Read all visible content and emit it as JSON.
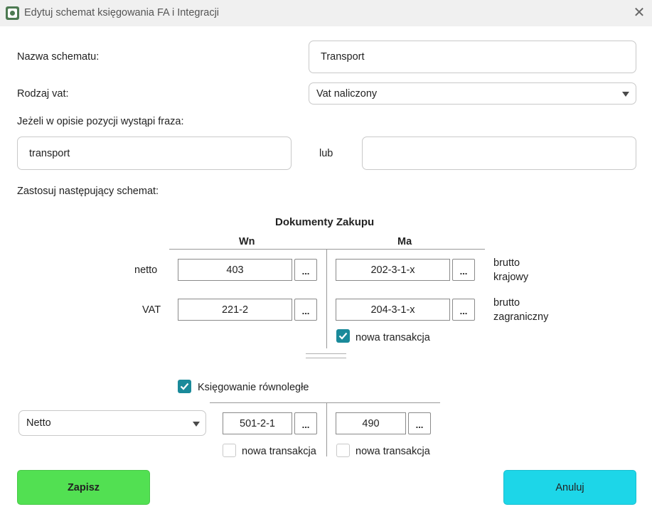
{
  "window": {
    "title": "Edytuj schemat księgowania FA i Integracji"
  },
  "form": {
    "scheme_name_label": "Nazwa schematu:",
    "scheme_name_value": "Transport",
    "vat_type_label": "Rodzaj vat:",
    "vat_type_value": "Vat naliczony",
    "phrase_label": "Jeżeli w opisie pozycji wystąpi fraza:",
    "phrase1_value": "transport",
    "or_label": "lub",
    "phrase2_value": "",
    "apply_label": "Zastosuj następujący schemat:"
  },
  "schema": {
    "header": "Dokumenty Zakupu",
    "col_wn": "Wn",
    "col_ma": "Ma",
    "rows": [
      {
        "label": "netto",
        "wn": "403",
        "ma": "202-3-1-x",
        "right_line1": "brutto",
        "right_line2": "krajowy"
      },
      {
        "label": "VAT",
        "wn": "221-2",
        "ma": "204-3-1-x",
        "right_line1": "brutto",
        "right_line2": "zagraniczny"
      }
    ],
    "dots_label": "...",
    "new_transaction_label": "nowa transakcja",
    "new_transaction_checked": true
  },
  "parallel": {
    "label": "Księgowanie równoległe",
    "checked": true,
    "select_value": "Netto",
    "wn": "501-2-1",
    "ma": "490",
    "wn_new_transaction_label": "nowa transakcja",
    "ma_new_transaction_label": "nowa transakcja",
    "wn_new_transaction_checked": false,
    "ma_new_transaction_checked": false
  },
  "buttons": {
    "save": "Zapisz",
    "cancel": "Anuluj"
  },
  "colors": {
    "save": "#52e052",
    "cancel": "#1dd6e8",
    "checkbox": "#1a8a9a"
  }
}
